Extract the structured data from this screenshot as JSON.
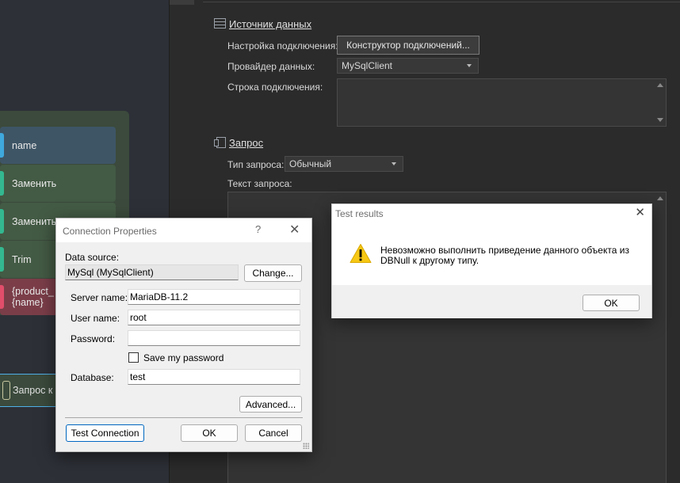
{
  "canvas": {
    "nodes": [
      {
        "label": "name",
        "color": "#3fa8dd"
      },
      {
        "label": "Заменить",
        "color": "#33b890"
      },
      {
        "label": "Заменить",
        "color": "#33b890"
      },
      {
        "label": "Trim",
        "color": "#33b890"
      },
      {
        "label_line1": "{product_",
        "label_line2": "{name}",
        "color": "#e04e6a"
      }
    ],
    "query_node": {
      "label": "Запрос к С"
    }
  },
  "panel": {
    "data_source": {
      "title": "Источник данных",
      "conn_setup_label": "Настройка подключения:",
      "conn_builder_button": "Конструктор подключений...",
      "provider_label": "Провайдер данных:",
      "provider_value": "MySqlClient",
      "conn_string_label": "Строка подключения:"
    },
    "query": {
      "title": "Запрос",
      "type_label": "Тип запроса:",
      "type_value": "Обычный",
      "text_label": "Текст запроса:"
    }
  },
  "test_dialog": {
    "title": "Test results",
    "message": "Невозможно выполнить приведение данного объекта из DBNull к другому типу.",
    "ok_label": "OK",
    "icon": "warning-icon"
  },
  "conn_dialog": {
    "title": "Connection Properties",
    "help_glyph": "?",
    "close_glyph": "✕",
    "data_source_label": "Data source:",
    "data_source_value": "MySql (MySqlClient)",
    "change_label": "Change...",
    "server_label": "Server name:",
    "server_value": "MariaDB-11.2",
    "user_label": "User name:",
    "user_value": "root",
    "password_label": "Password:",
    "password_value": "",
    "save_password_label": "Save my password",
    "save_password_checked": false,
    "database_label": "Database:",
    "database_value": "test",
    "advanced_label": "Advanced...",
    "test_label": "Test Connection",
    "ok_label": "OK",
    "cancel_label": "Cancel"
  }
}
